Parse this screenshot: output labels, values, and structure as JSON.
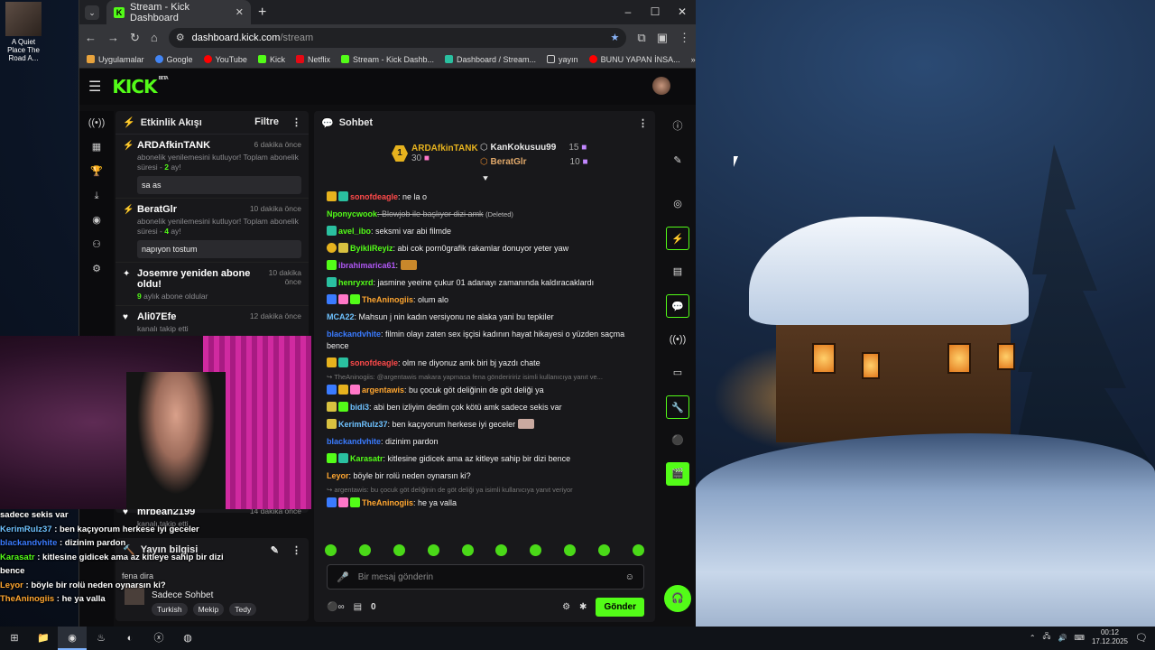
{
  "desktop": {
    "icon_label": "A Quiet Place The Road A..."
  },
  "browser": {
    "tab_title": "Stream - Kick Dashboard",
    "url_host": "dashboard.kick.com",
    "url_path": "/stream",
    "bookmarks": [
      "Uygulamalar",
      "Google",
      "YouTube",
      "Kick",
      "Netflix",
      "Stream - Kick Dashb...",
      "Dashboard / Stream...",
      "yayın",
      "BUNU YAPAN İNSA..."
    ]
  },
  "kick": {
    "logo": "KICK",
    "beta": "BETA"
  },
  "activity": {
    "title": "Etkinlik Akışı",
    "filter": "Filtre",
    "events": [
      {
        "name": "ARDAfkinTANK",
        "time": "6 dakika önce",
        "sub_a": "abonelik yenilemesini kutluyor! Toplam abonelik süresi - ",
        "sub_b": "2",
        "sub_c": " ay!",
        "msg": "sa as"
      },
      {
        "name": "BeratGlr",
        "time": "10 dakika önce",
        "sub_a": "abonelik yenilemesini kutluyor! Toplam abonelik süresi - ",
        "sub_b": "4",
        "sub_c": " ay!",
        "msg": "napıyon tostum"
      },
      {
        "name": "Josemre yeniden abone oldu!",
        "time": "10 dakika önce",
        "sub_a": "",
        "sub_b": "9",
        "sub_c": " aylık abone oldular"
      },
      {
        "name": "Ali07Efe",
        "time": "12 dakika önce",
        "sub_a": "kanalı takip etti"
      },
      {
        "name": "mrbean2199",
        "time": "14 dakika önce",
        "sub_a": "kanalı takip etti"
      }
    ]
  },
  "stream_info": {
    "title": "Yayın bilgisi",
    "category": "Sadece Sohbet",
    "tags": [
      "Turkish",
      "Mekip",
      "Tedy"
    ]
  },
  "chat": {
    "title": "Sohbet",
    "leaders": [
      {
        "rank": "1",
        "name": "ARDAfkinTANK",
        "count": "30"
      },
      {
        "rank": "2",
        "name": "KanKokusuu99",
        "count": "15"
      },
      {
        "rank": "3",
        "name": "BeratGlr",
        "count": "10"
      }
    ],
    "messages": [
      {
        "user": "sonofdeagle",
        "color": "#ff4a4a",
        "text": ": ne la o"
      },
      {
        "user": "Nponycwook",
        "color": "#53fc18",
        "text": ": Blowjob ile başlıyor dizi amk",
        "note": "(Deleted)"
      },
      {
        "user": "avel_ibo",
        "color": "#53fc18",
        "text": ": seksmi var abi filmde"
      },
      {
        "user": "ByikliReyiz",
        "color": "#53fc18",
        "text": ": abi cok porn0grafik rakamlar donuyor yeter yaw"
      },
      {
        "user": "ibrahimarica61",
        "color": "#b057f5",
        "text": ":"
      },
      {
        "user": "henryxrd",
        "color": "#53fc18",
        "text": ": jasmine yeeine çukur 01 adanayı zamanında kaldıracaklardı"
      },
      {
        "user": "TheAninogiis",
        "color": "#ffa630",
        "text": ": olum alo"
      },
      {
        "user": "MCA22",
        "color": "#6ec2ff",
        "text": ": Mahsun j nin kadın versiyonu ne alaka yani bu tepkiler"
      },
      {
        "user": "blackandvhite",
        "color": "#3a7bff",
        "text": ": filmin olayı zaten sex işçisi kadının hayat hikayesi o yüzden saçma bence"
      },
      {
        "user": "sonofdeagle",
        "color": "#ff4a4a",
        "text": ": olm ne diyonuz amk biri bj yazdı chate"
      },
      {
        "reply": "↪ TheAninogiis: @argentawis makara yapmasa fena gönderiririz isimli kullanıcıya yanıt ve..."
      },
      {
        "user": "argentawis",
        "color": "#ffa630",
        "text": ": bu çocuk göt deliğinin de göt deliği ya"
      },
      {
        "user": "bidi3",
        "color": "#6ec2ff",
        "text": ": abi ben izliyim dedim çok kötü amk sadece sekis var"
      },
      {
        "user": "KerimRulz37",
        "color": "#6ec2ff",
        "text": ": ben kaçıyorum herkese iyi geceler"
      },
      {
        "user": "blackandvhite",
        "color": "#3a7bff",
        "text": ": dizinim pardon"
      },
      {
        "user": "Karasatr",
        "color": "#53fc18",
        "text": ": kitlesine gidicek ama az kitleye sahip bir dizi bence"
      },
      {
        "user": "Leyor",
        "color": "#ffa630",
        "text": ": böyle bir rolü neden oynarsın ki?"
      },
      {
        "reply": "↪ argentawis: bu çocuk göt deliğinin de göt deliği ya isimli kullanıcıya yanıt veriyor"
      },
      {
        "user": "TheAninogiis",
        "color": "#ffa630",
        "text": ": he ya valla"
      }
    ],
    "placeholder": "Bir mesaj gönderin",
    "points": "0",
    "send_label": "Gönder"
  },
  "overlay_chat": [
    {
      "user": "",
      "text": "sadece sekis var"
    },
    {
      "user": "KerimRulz37",
      "text": " : ben kaçıyorum herkese iyi geceler"
    },
    {
      "user": "blackandvhite",
      "text": " : dizinim pardon"
    },
    {
      "user": "Karasatr",
      "text": " : kitlesine gidicek ama az kitleye sahip bir dizi bence"
    },
    {
      "user": "Leyor",
      "text": " : böyle bir rolü neden oynarsın ki?"
    },
    {
      "user": "TheAninogiis",
      "text": " : he ya valla"
    }
  ],
  "overlay_fragment": "fena dira",
  "taskbar": {
    "time": "00:12",
    "date": "17.12.2025"
  },
  "colors": {
    "accent": "#53fc18"
  }
}
